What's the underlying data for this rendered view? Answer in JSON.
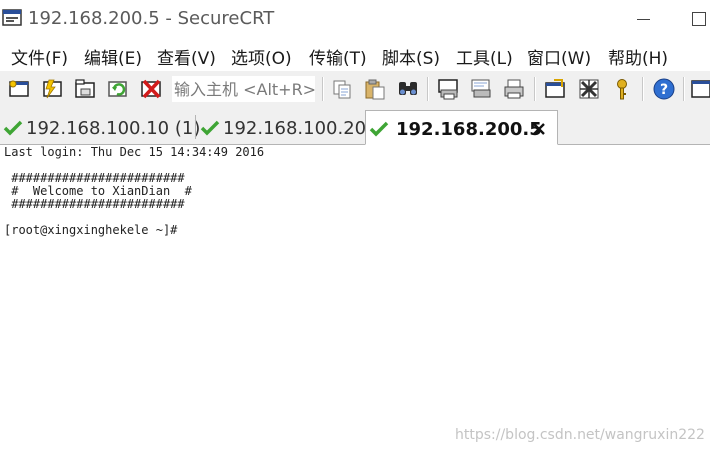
{
  "window": {
    "title": "192.168.200.5 - SecureCRT"
  },
  "menu": [
    "文件(F)",
    "编辑(E)",
    "查看(V)",
    "选项(O)",
    "传输(T)",
    "脚本(S)",
    "工具(L)",
    "窗口(W)",
    "帮助(H)"
  ],
  "toolbar": {
    "quick_connect_placeholder": "输入主机 <Alt+R>",
    "buttons": [
      "connect-icon",
      "quick-connect-icon",
      "connect-in-tab-icon",
      "reconnect-icon",
      "disconnect-icon",
      "copy-icon",
      "paste-icon",
      "find-icon",
      "print-screen-icon",
      "print-selection-icon",
      "print-icon",
      "session-options-icon",
      "global-options-icon",
      "keymap-icon",
      "help-icon",
      "sftp-icon"
    ]
  },
  "tabs": [
    {
      "label": "192.168.100.10 (1)",
      "active": false,
      "status_icon": "check-icon"
    },
    {
      "label": "192.168.100.20",
      "active": false,
      "status_icon": "check-icon"
    },
    {
      "label": "192.168.200.5",
      "active": true,
      "status_icon": "check-icon"
    }
  ],
  "terminal": {
    "lines": [
      "Last login: Thu Dec 15 14:34:49 2016",
      "",
      " ########################",
      " #  Welcome to XianDian  #",
      " ########################",
      "",
      "[root@xingxinghekele ~]#"
    ]
  },
  "watermark": "https://blog.csdn.net/wangruxin222",
  "colors": {
    "check_green": "#3fa535",
    "toolbar_bg": "#f0f0f0",
    "title_text": "#5a5a5a"
  }
}
